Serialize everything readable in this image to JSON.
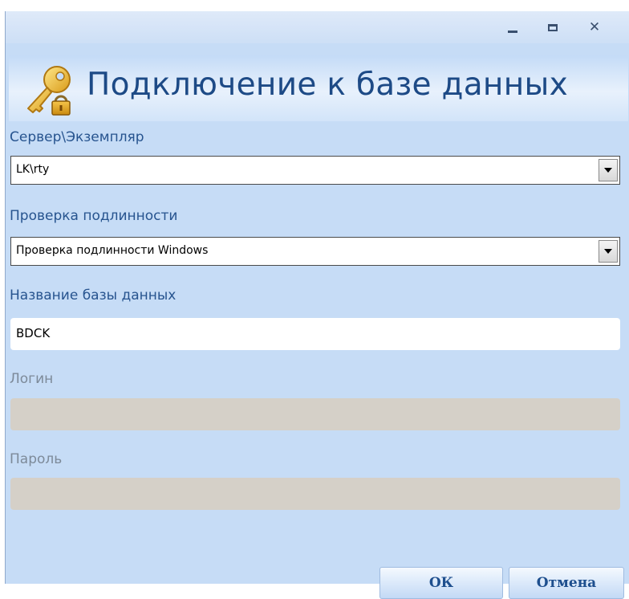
{
  "window": {
    "title": "",
    "controls": {
      "minimize": "minimize-icon",
      "maximize": "maximize-icon",
      "close": "close-icon"
    }
  },
  "header": {
    "icon": "key-icon",
    "title": "Подключение к базе данных"
  },
  "form": {
    "server": {
      "label": "Сервер\\Экземпляр",
      "value": "LK\\rty"
    },
    "auth": {
      "label": "Проверка подлинности",
      "value": "Проверка подлинности Windows"
    },
    "database": {
      "label": "Название базы данных",
      "value": "BDCK"
    },
    "login": {
      "label": "Логин",
      "value": ""
    },
    "password": {
      "label": "Пароль",
      "value": ""
    }
  },
  "buttons": {
    "ok": "ОК",
    "cancel": "Отмена"
  },
  "colors": {
    "background": "#c6dcf6",
    "label": "#27548f",
    "disabled_label": "#7d8a99",
    "disabled_field": "#d5d0c8",
    "title": "#1d4a86"
  }
}
